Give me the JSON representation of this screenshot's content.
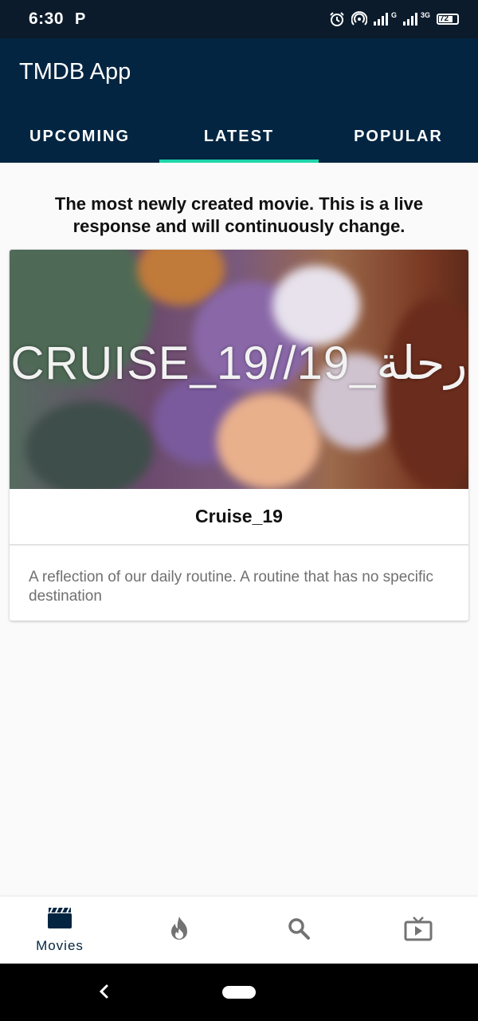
{
  "status_bar": {
    "time": "6:30",
    "app_indicator": "P",
    "network_1_tag": "G",
    "network_2_tag": "3G",
    "battery": "72"
  },
  "app_bar": {
    "title": "TMDB App",
    "tabs": [
      {
        "label": "UPCOMING",
        "active": false
      },
      {
        "label": "LATEST",
        "active": true
      },
      {
        "label": "POPULAR",
        "active": false
      }
    ],
    "accent": "#1ed5a9",
    "background": "#032541"
  },
  "content": {
    "description": "The most newly created movie. This is a live response and will continuously change.",
    "movie": {
      "poster_caption": "CRUISE_19//19_رحلة",
      "title": "Cruise_19",
      "overview": "A reflection of our daily routine. A routine that has no specific destination"
    }
  },
  "bottom_nav": {
    "items": [
      {
        "icon": "clapperboard-icon",
        "label": "Movies",
        "active": true
      },
      {
        "icon": "flame-icon",
        "label": "",
        "active": false
      },
      {
        "icon": "search-icon",
        "label": "",
        "active": false
      },
      {
        "icon": "tv-icon",
        "label": "",
        "active": false
      }
    ]
  }
}
